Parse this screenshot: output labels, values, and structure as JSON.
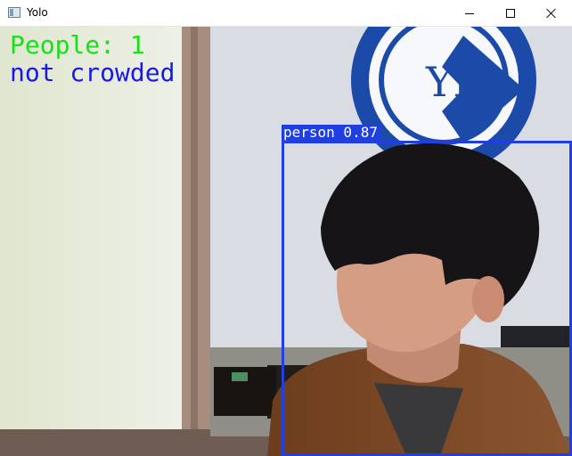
{
  "window": {
    "title": "Yolo",
    "icon": "opencv-window-icon"
  },
  "overlay": {
    "people_count": "People: 1",
    "crowd_status": "not crowded",
    "count_color": "#18e018",
    "status_color": "#1818e8"
  },
  "detection": {
    "label": "person 0.87",
    "color": "#1f3fe0"
  },
  "sign": {
    "letters": "YH"
  }
}
